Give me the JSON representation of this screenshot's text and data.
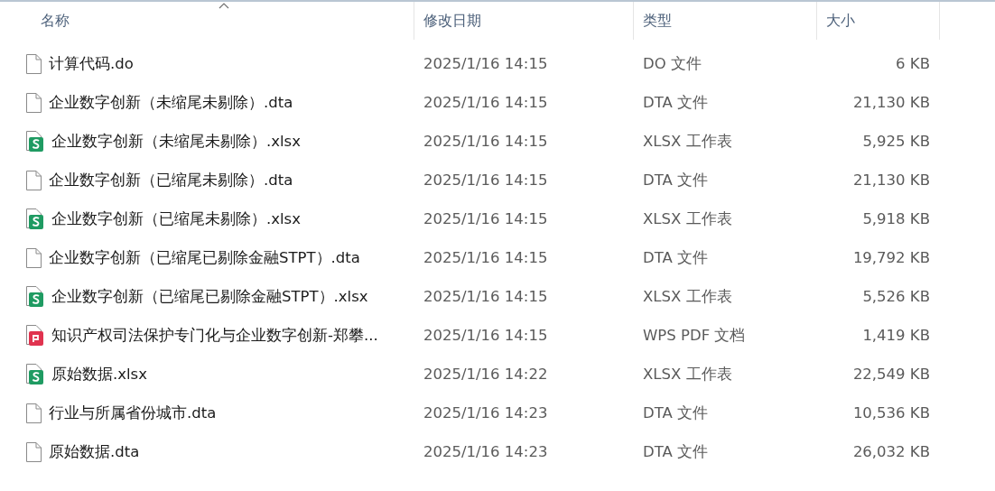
{
  "columns": [
    {
      "label": "名称",
      "sorted": true
    },
    {
      "label": "修改日期",
      "sorted": false
    },
    {
      "label": "类型",
      "sorted": false
    },
    {
      "label": "大小",
      "sorted": false
    }
  ],
  "files": [
    {
      "name": "计算代码.do",
      "date": "2025/1/16 14:15",
      "type": "DO 文件",
      "size": "6 KB",
      "kind": "plain"
    },
    {
      "name": "企业数字创新（未缩尾未剔除）.dta",
      "date": "2025/1/16 14:15",
      "type": "DTA 文件",
      "size": "21,130 KB",
      "kind": "plain"
    },
    {
      "name": "企业数字创新（未缩尾未剔除）.xlsx",
      "date": "2025/1/16 14:15",
      "type": "XLSX 工作表",
      "size": "5,925 KB",
      "kind": "sheet"
    },
    {
      "name": "企业数字创新（已缩尾未剔除）.dta",
      "date": "2025/1/16 14:15",
      "type": "DTA 文件",
      "size": "21,130 KB",
      "kind": "plain"
    },
    {
      "name": "企业数字创新（已缩尾未剔除）.xlsx",
      "date": "2025/1/16 14:15",
      "type": "XLSX 工作表",
      "size": "5,918 KB",
      "kind": "sheet"
    },
    {
      "name": "企业数字创新（已缩尾已剔除金融STPT）.dta",
      "date": "2025/1/16 14:15",
      "type": "DTA 文件",
      "size": "19,792 KB",
      "kind": "plain"
    },
    {
      "name": "企业数字创新（已缩尾已剔除金融STPT）.xlsx",
      "date": "2025/1/16 14:15",
      "type": "XLSX 工作表",
      "size": "5,526 KB",
      "kind": "sheet"
    },
    {
      "name": "知识产权司法保护专门化与企业数字创新-郑攀...",
      "date": "2025/1/16 14:15",
      "type": "WPS PDF 文档",
      "size": "1,419 KB",
      "kind": "pdf"
    },
    {
      "name": "原始数据.xlsx",
      "date": "2025/1/16 14:22",
      "type": "XLSX 工作表",
      "size": "22,549 KB",
      "kind": "sheet"
    },
    {
      "name": "行业与所属省份城市.dta",
      "date": "2025/1/16 14:23",
      "type": "DTA 文件",
      "size": "10,536 KB",
      "kind": "plain"
    },
    {
      "name": "原始数据.dta",
      "date": "2025/1/16 14:23",
      "type": "DTA 文件",
      "size": "26,032 KB",
      "kind": "plain"
    }
  ]
}
